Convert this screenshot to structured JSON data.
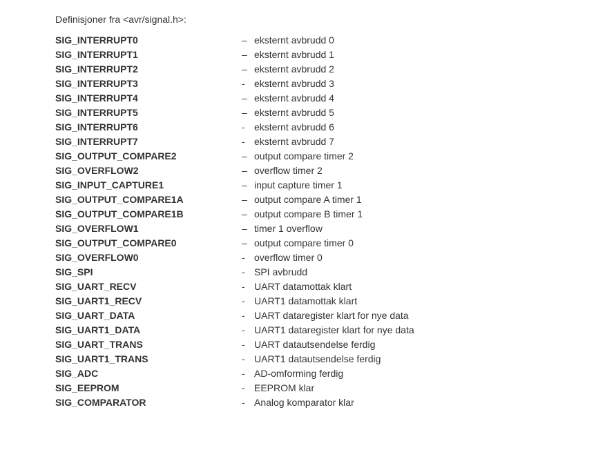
{
  "heading": "Definisjoner fra <avr/signal.h>:",
  "en_dash": "–",
  "hyphen": "-",
  "defs": [
    {
      "name": "SIG_INTERRUPT0",
      "sepKey": "en_dash",
      "desc": "eksternt avbrudd 0"
    },
    {
      "name": "SIG_INTERRUPT1",
      "sepKey": "en_dash",
      "desc": "eksternt avbrudd 1"
    },
    {
      "name": "SIG_INTERRUPT2",
      "sepKey": "en_dash",
      "desc": "eksternt avbrudd 2"
    },
    {
      "name": "SIG_INTERRUPT3",
      "sepKey": "hyphen",
      "desc": "eksternt avbrudd 3"
    },
    {
      "name": "SIG_INTERRUPT4",
      "sepKey": "en_dash",
      "desc": "eksternt avbrudd 4"
    },
    {
      "name": "SIG_INTERRUPT5",
      "sepKey": "en_dash",
      "desc": "eksternt avbrudd 5"
    },
    {
      "name": "SIG_INTERRUPT6",
      "sepKey": "hyphen",
      "desc": "eksternt avbrudd 6"
    },
    {
      "name": "SIG_INTERRUPT7",
      "sepKey": "hyphen",
      "desc": "eksternt avbrudd 7"
    },
    {
      "name": "SIG_OUTPUT_COMPARE2",
      "sepKey": "en_dash",
      "desc": "output compare timer 2"
    },
    {
      "name": "SIG_OVERFLOW2",
      "sepKey": "en_dash",
      "desc": "overflow timer 2"
    },
    {
      "name": "SIG_INPUT_CAPTURE1",
      "sepKey": "en_dash",
      "desc": "input capture timer 1"
    },
    {
      "name": "SIG_OUTPUT_COMPARE1A",
      "sepKey": "en_dash",
      "desc": "output compare A timer 1"
    },
    {
      "name": "SIG_OUTPUT_COMPARE1B",
      "sepKey": "en_dash",
      "desc": "output compare B timer 1"
    },
    {
      "name": "SIG_OVERFLOW1",
      "sepKey": "en_dash",
      "desc": "timer 1 overflow"
    },
    {
      "name": "SIG_OUTPUT_COMPARE0",
      "sepKey": "en_dash",
      "desc": "output compare timer 0"
    },
    {
      "name": "SIG_OVERFLOW0",
      "sepKey": "hyphen",
      "desc": "overflow timer 0"
    },
    {
      "name": "SIG_SPI",
      "sepKey": "hyphen",
      "desc": "SPI avbrudd"
    },
    {
      "name": "SIG_UART_RECV",
      "sepKey": "hyphen",
      "desc": "UART datamottak klart"
    },
    {
      "name": "SIG_UART1_RECV",
      "sepKey": "hyphen",
      "desc": "UART1 datamottak klart"
    },
    {
      "name": "SIG_UART_DATA",
      "sepKey": "hyphen",
      "desc": "UART dataregister klart for nye data"
    },
    {
      "name": "SIG_UART1_DATA",
      "sepKey": "hyphen",
      "desc": "UART1 dataregister klart for nye data"
    },
    {
      "name": "SIG_UART_TRANS",
      "sepKey": "hyphen",
      "desc": "UART datautsendelse ferdig"
    },
    {
      "name": "SIG_UART1_TRANS",
      "sepKey": "hyphen",
      "desc": "UART1 datautsendelse ferdig"
    },
    {
      "name": "SIG_ADC",
      "sepKey": "hyphen",
      "desc": "AD-omforming ferdig"
    },
    {
      "name": "SIG_EEPROM",
      "sepKey": "hyphen",
      "desc": "EEPROM klar"
    },
    {
      "name": "SIG_COMPARATOR",
      "sepKey": "hyphen",
      "desc": "Analog komparator klar"
    }
  ]
}
